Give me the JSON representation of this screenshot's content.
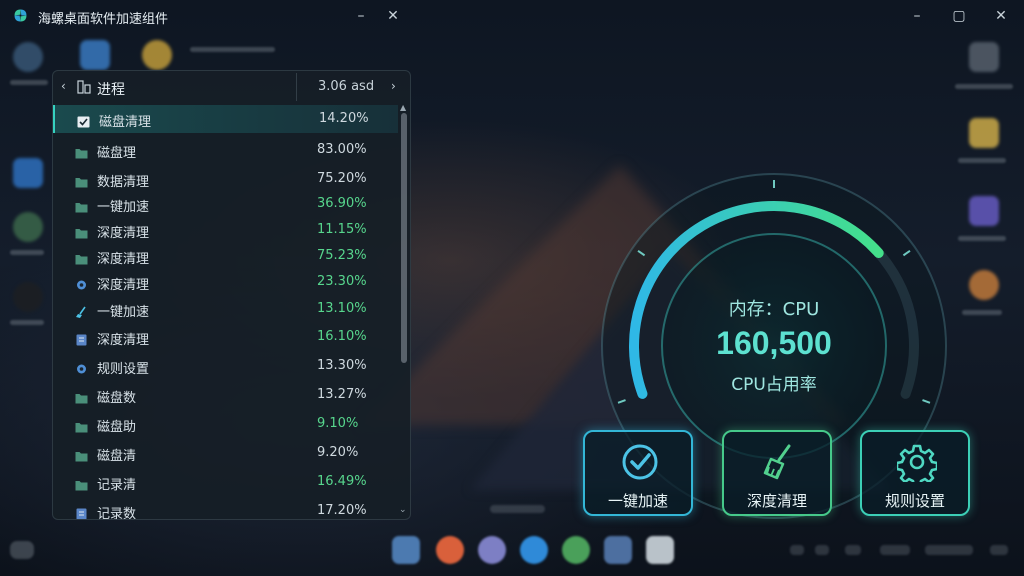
{
  "app": {
    "title": "海螺桌面软件加速组件"
  },
  "window_controls": {
    "minimize": "–",
    "close": "✕",
    "min2": "–",
    "max2": "▢",
    "close2": "✕"
  },
  "panel": {
    "back_arrow": "‹",
    "title": "进程",
    "header_value": "3.06 asd",
    "forward_arrow": "›",
    "rows": [
      {
        "name": "磁盘清理",
        "pct": "14.20%",
        "icon": "checkbox-icon"
      },
      {
        "name": "磁盘理",
        "pct": "83.00%",
        "icon": "folder-icon"
      },
      {
        "name": "数据清理",
        "pct": "75.20%",
        "icon": "folder-icon"
      },
      {
        "name": "一键加速",
        "pct": "36.90%",
        "icon": "folder-icon"
      },
      {
        "name": "深度清理",
        "pct": "11.15%",
        "icon": "folder-icon"
      },
      {
        "name": "深度清理",
        "pct": "75.23%",
        "icon": "folder-icon"
      },
      {
        "name": "深度清理",
        "pct": "23.30%",
        "icon": "gear-icon"
      },
      {
        "name": "一键加速",
        "pct": "13.10%",
        "icon": "broom-icon"
      },
      {
        "name": "深度清理",
        "pct": "16.10%",
        "icon": "file-icon"
      },
      {
        "name": "规则设置",
        "pct": "13.30%",
        "icon": "gear-icon"
      },
      {
        "name": "磁盘数",
        "pct": "13.27%",
        "icon": "folder-icon"
      },
      {
        "name": "磁盘助",
        "pct": "9.10%",
        "icon": "folder-icon"
      },
      {
        "name": "磁盘清",
        "pct": "9.20%",
        "icon": "folder-icon"
      },
      {
        "name": "记录清",
        "pct": "16.49%",
        "icon": "folder-icon"
      },
      {
        "name": "记录数",
        "pct": "17.20%",
        "icon": "file-icon"
      }
    ]
  },
  "gauge": {
    "line1": "内存：CPU",
    "value": "160,500",
    "line3": "CPU占用率",
    "level": 0.72
  },
  "actions": [
    {
      "label": "一键加速",
      "icon": "check-circle-icon"
    },
    {
      "label": "深度清理",
      "icon": "broom-icon"
    },
    {
      "label": "规则设置",
      "icon": "gear-icon"
    }
  ],
  "colors": {
    "accent_blue": "#33b6d6",
    "accent_green": "#46c98a",
    "accent_teal": "#3ccfb6",
    "value_green": "#57d68d"
  }
}
